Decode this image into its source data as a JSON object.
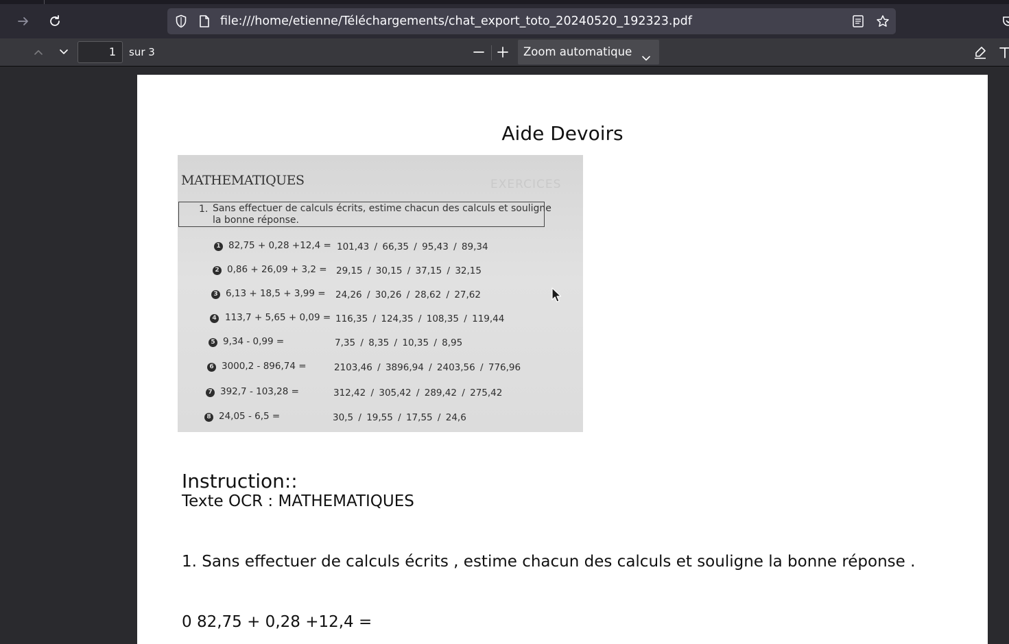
{
  "browser": {
    "url": "file:///home/etienne/Téléchargements/chat_export_toto_20240520_192323.pdf",
    "icons": [
      "forward-arrow-icon",
      "reload-icon",
      "shield-icon",
      "page-icon",
      "reader-view-icon",
      "bookmark-star-icon",
      "pocket-icon"
    ]
  },
  "pdf_toolbar": {
    "page_number": "1",
    "page_total": "sur 3",
    "zoom": "Zoom automatique",
    "icons": [
      "previous-page-icon",
      "next-page-icon",
      "zoom-out-icon",
      "zoom-in-icon",
      "highlight-icon",
      "text-icon"
    ]
  },
  "document": {
    "title": "Aide Devoirs",
    "photo": {
      "heading": "MATHEMATIQUES",
      "ghost_text": "EXERCICES",
      "exercise_number": "1.",
      "instruction_line1": "Sans effectuer de calculs écrits, estime chacun des calculs et souligne",
      "instruction_line2": "la bonne réponse.",
      "rows": [
        {
          "badge": "1",
          "expr": "82,75 + 0,28 +12,4  =",
          "answers": "101,43  /  66,35  /  95,43  /  89,34"
        },
        {
          "badge": "2",
          "expr": "0,86 + 26,09 + 3,2  =",
          "answers": "29,15  /  30,15  /  37,15  /  32,15"
        },
        {
          "badge": "3",
          "expr": "6,13 + 18,5 + 3,99  =",
          "answers": "24,26  /  30,26  /  28,62  /  27,62"
        },
        {
          "badge": "4",
          "expr": "113,7 + 5,65 + 0,09  =",
          "answers": "116,35  /  124,35  /  108,35  /  119,44"
        },
        {
          "badge": "5",
          "expr": "9,34 - 0,99  =",
          "answers": "7,35  /  8,35  /  10,35  /  8,95"
        },
        {
          "badge": "6",
          "expr": "3000,2 - 896,74  =",
          "answers": "2103,46  /  3896,94  /  2403,56  /  776,96"
        },
        {
          "badge": "7",
          "expr": "392,7 - 103,28  =",
          "answers": "312,42  /  305,42  /  289,42  /  275,42"
        },
        {
          "badge": "8",
          "expr": "24,05 - 6,5  =",
          "answers": "30,5  /  19,55  /  17,55  /  24,6"
        }
      ]
    },
    "instruction_label": "Instruction::",
    "ocr_line": "Texte OCR : MATHEMATIQUES",
    "question_line": "1. Sans effectuer de calculs écrits , estime chacun des calculs et souligne la bonne réponse .",
    "partial_line": "0 82,75 + 0,28 +12,4 ="
  }
}
